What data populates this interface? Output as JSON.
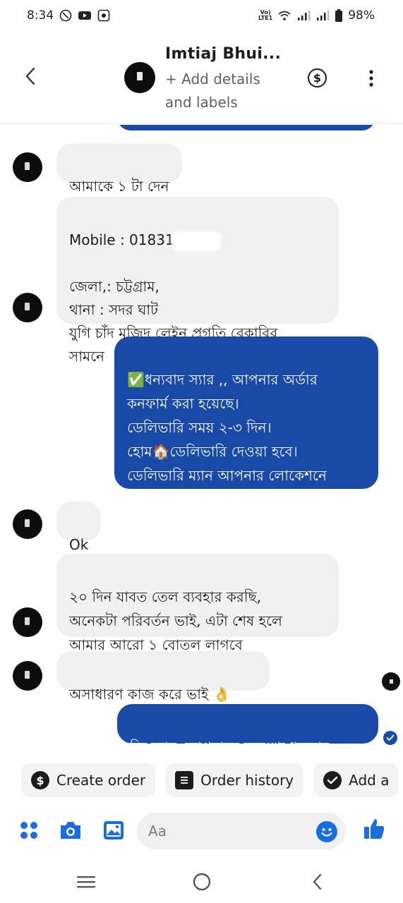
{
  "status_bar": {
    "time": "8:34",
    "volte": "Vo)\nLTE1",
    "battery": "98%"
  },
  "header": {
    "contact_name": "Imtiaj Bhui...",
    "subtitle": "+ Add details\nand labels",
    "dollar_symbol": "$"
  },
  "messages": [
    {
      "direction": "in",
      "text": "আমাকে ১ টা দেন"
    },
    {
      "direction": "in",
      "text_mobile": "Mobile : 01831",
      "text_rest": "জেলা,: চট্টগ্রাম,\nথানা : সদর ঘাট\nযুগি চাঁদ মজিদ লেইন প্রগতি বেকারির\nসামনে"
    },
    {
      "direction": "out",
      "text": "✅ধন্যবাদ স্যার ,, আপনার অর্ডার\nকনফার্ম করা হয়েছে।\nডেলিভারি সময় ২-৩ দিন।\nহোম🏠ডেলিভারি দেওয়া হবে।\nডেলিভারি ম্যান আপনার লোকেশনে\nগিয়ে পৌঁছে দেবে।"
    },
    {
      "direction": "in",
      "text": "Ok"
    },
    {
      "direction": "in",
      "text": "২০ দিন যাবত তেল ব্যবহার করছি,\nঅনেকটা পরিবর্তন ভাই, এটা শেষ হলে\nআমার আরো ১ বোতল লাগবে"
    },
    {
      "direction": "in",
      "text": "অসাধারণ কাজ করে ভাই 👌"
    },
    {
      "direction": "out",
      "text": "জি স্যার, আপনাকে অসংখ্য ধন্যবাদ"
    }
  ],
  "quick_actions": {
    "create_order": "Create order",
    "order_history": "Order history",
    "add_label": "Add a"
  },
  "composer": {
    "placeholder": "Aa"
  },
  "colors": {
    "accent": "#1a4aa8",
    "incoming_bubble": "#f0f0f0",
    "icon_blue": "#1a6de0"
  }
}
